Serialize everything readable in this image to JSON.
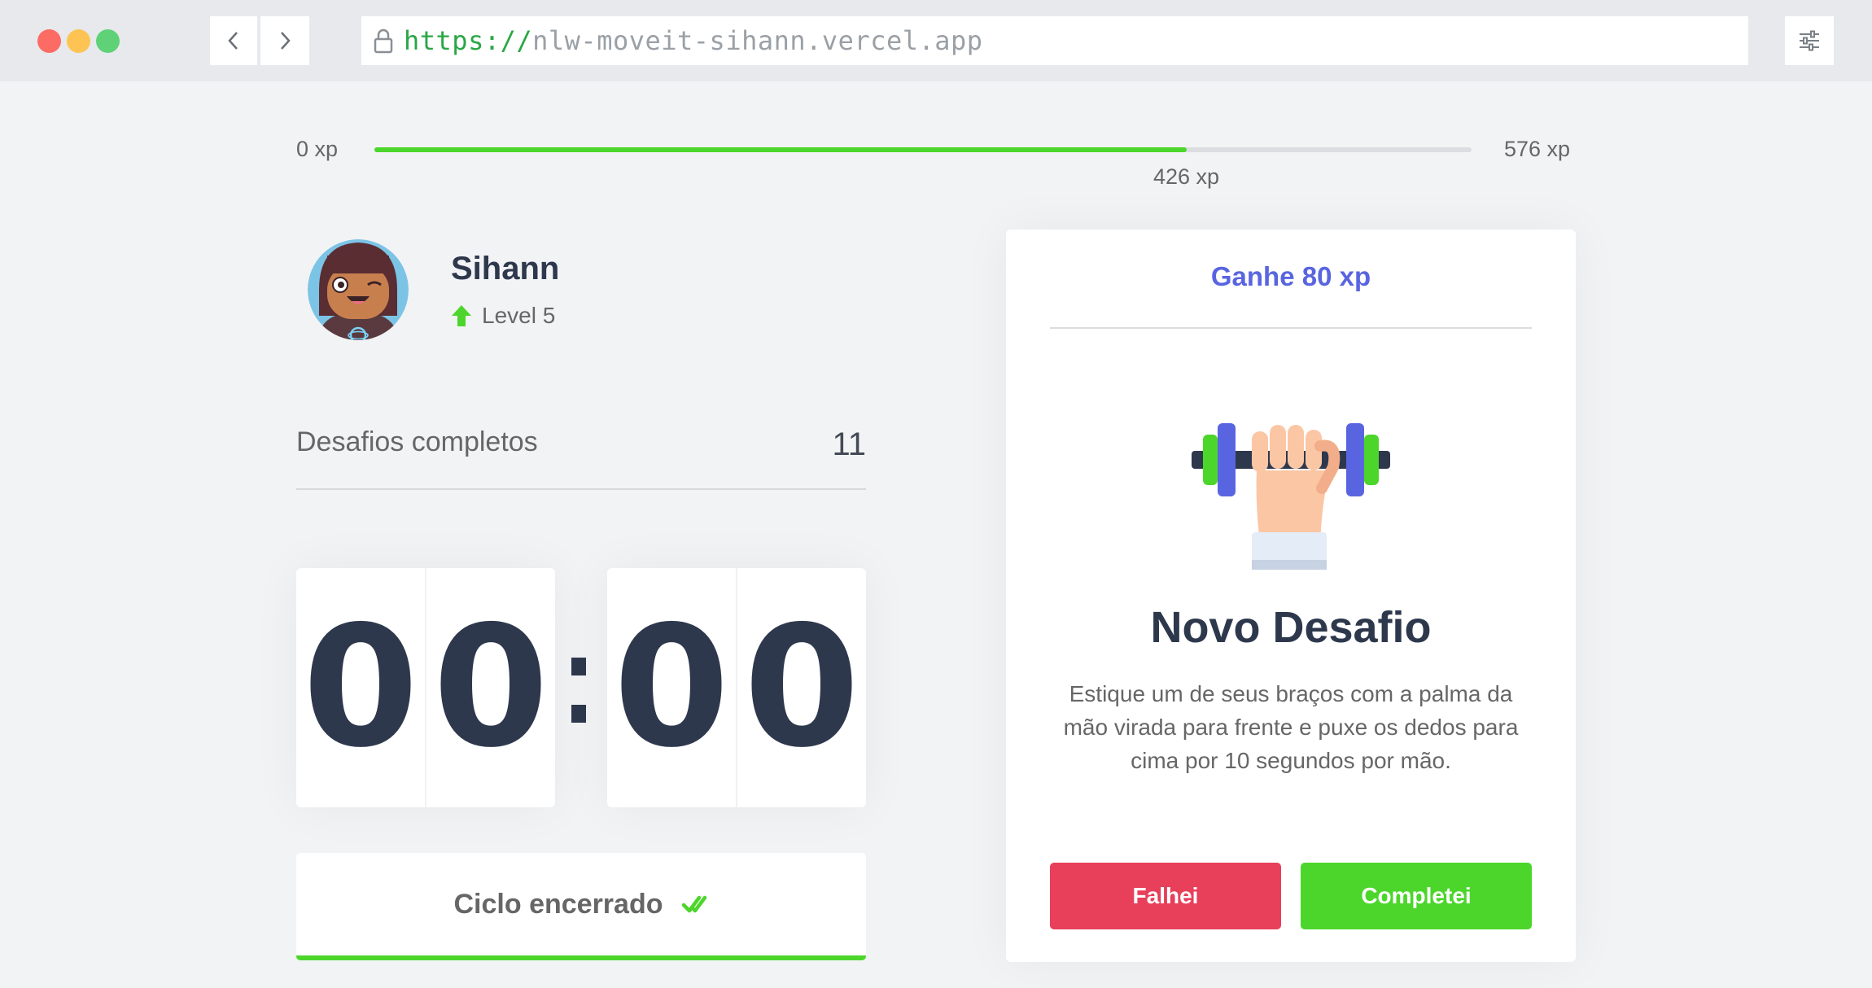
{
  "browser": {
    "url_scheme": "https://",
    "url_host": "nlw-moveit-sihann.vercel.app"
  },
  "experience": {
    "min_label": "0 xp",
    "max_label": "576 xp",
    "current_label": "426 xp",
    "current": 426,
    "max": 576,
    "progress_fraction": 0.74
  },
  "profile": {
    "name": "Sihann",
    "level_label": "Level 5"
  },
  "completed_challenges": {
    "label": "Desafios completos",
    "value": "11"
  },
  "countdown": {
    "minute_left": "0",
    "minute_right": "0",
    "second_left": "0",
    "second_right": "0"
  },
  "cycle_button": {
    "label": "Ciclo encerrado"
  },
  "challenge": {
    "reward": "Ganhe 80 xp",
    "title": "Novo Desafio",
    "description": "Estique um de seus braços com a palma da mão virada para frente e puxe os dedos para cima por 10 segundos por mão.",
    "fail_label": "Falhei",
    "success_label": "Completei"
  },
  "icons": {
    "lock": "lock-icon",
    "back": "chevron-left-icon",
    "forward": "chevron-right-icon",
    "settings": "sliders-icon",
    "level_up": "arrow-up-icon",
    "check": "double-check-icon",
    "challenge": "dumbbell-icon"
  },
  "colors": {
    "accent_green": "#4cd62b",
    "danger_red": "#e83f5b",
    "brand_blue": "#5965e0",
    "title_dark": "#2e384d",
    "text_gray": "#666666"
  }
}
